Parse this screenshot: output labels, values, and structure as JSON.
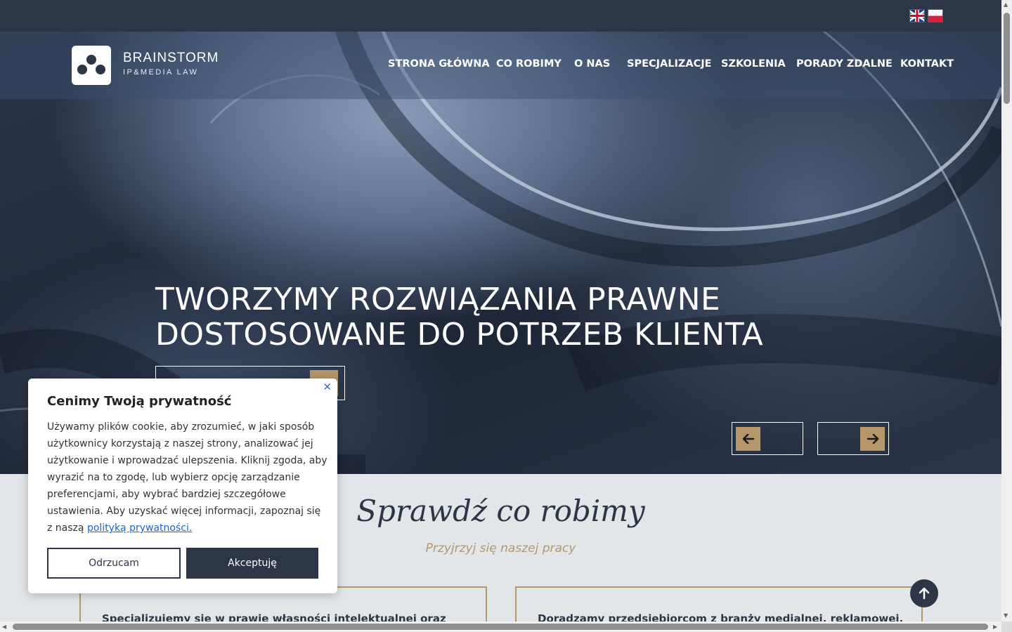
{
  "languages": [
    {
      "code": "en",
      "icon": "uk-flag-icon"
    },
    {
      "code": "pl",
      "icon": "poland-flag-icon"
    }
  ],
  "logo": {
    "name": "BRAINSTORM",
    "subtitle": "IP&MEDIA LAW"
  },
  "nav": [
    "STRONA GŁÓWNA",
    "CO ROBIMY",
    "O NAS",
    "SPECJALIZACJE",
    "SZKOLENIA",
    "PORADY ZDALNE",
    "KONTAKT"
  ],
  "hero": {
    "title_line1": "TWORZYMY ROZWIĄZANIA PRAWNE",
    "title_line2": "DOSTOSOWANE DO POTRZEB KLIENTA",
    "prev_icon": "arrow-left-icon",
    "next_icon": "arrow-right-icon"
  },
  "section": {
    "title": "Sprawdź co robimy",
    "subtitle": "Przyjrzyj się naszej pracy",
    "card1_text": "Specjalizujemy się w prawie własności intelektualnej oraz",
    "card2_text": "Doradzamy przedsiębiorcom z branży medialnej, reklamowej,"
  },
  "cookie": {
    "title": "Cenimy Twoją prywatność",
    "text": "Używamy plików cookie, aby zrozumieć, w jaki sposób użytkownicy korzystają z naszej strony, analizować jej użytkowanie i wprowadzać ulepszenia. Kliknij zgoda, aby wyrazić na to zgodę, lub wybierz opcję zarządzanie preferencjami, aby wybrać bardziej szczegółowe ustawienia. Aby uzyskać więcej informacji, zapoznaj się z naszą",
    "link": "polityką prywatności.",
    "reject": "Odrzucam",
    "accept": "Akceptuję",
    "close_icon": "close-icon"
  },
  "colors": {
    "navy": "#2c3646",
    "gold": "#b5976b",
    "section_bg": "#e3e6e8"
  }
}
